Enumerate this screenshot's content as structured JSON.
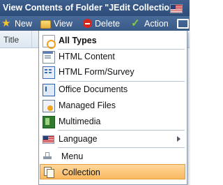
{
  "window": {
    "title": "View Contents of Folder \"JEdit Collection\"",
    "flag_icon": "us-flag-icon"
  },
  "toolbar": {
    "new_label": "New",
    "view_label": "View",
    "delete_label": "Delete",
    "action_label": "Action"
  },
  "list": {
    "column_title": "Title"
  },
  "menu": {
    "items": [
      {
        "label": "All Types",
        "icon": "all-types-icon"
      },
      {
        "label": "HTML Content",
        "icon": "html-content-icon"
      },
      {
        "label": "HTML Form/Survey",
        "icon": "html-form-icon"
      },
      {
        "label": "Office Documents",
        "icon": "office-documents-icon"
      },
      {
        "label": "Managed Files",
        "icon": "managed-files-icon"
      },
      {
        "label": "Multimedia",
        "icon": "multimedia-icon"
      },
      {
        "label": "Language",
        "icon": "us-flag-icon",
        "has_submenu": true
      },
      {
        "label": "Menu",
        "icon": "menu-icon"
      },
      {
        "label": "Collection",
        "icon": "collection-icon",
        "selected": true
      }
    ]
  },
  "colors": {
    "titlebar": "#2e4d78",
    "selected_highlight": "#f9b960"
  }
}
